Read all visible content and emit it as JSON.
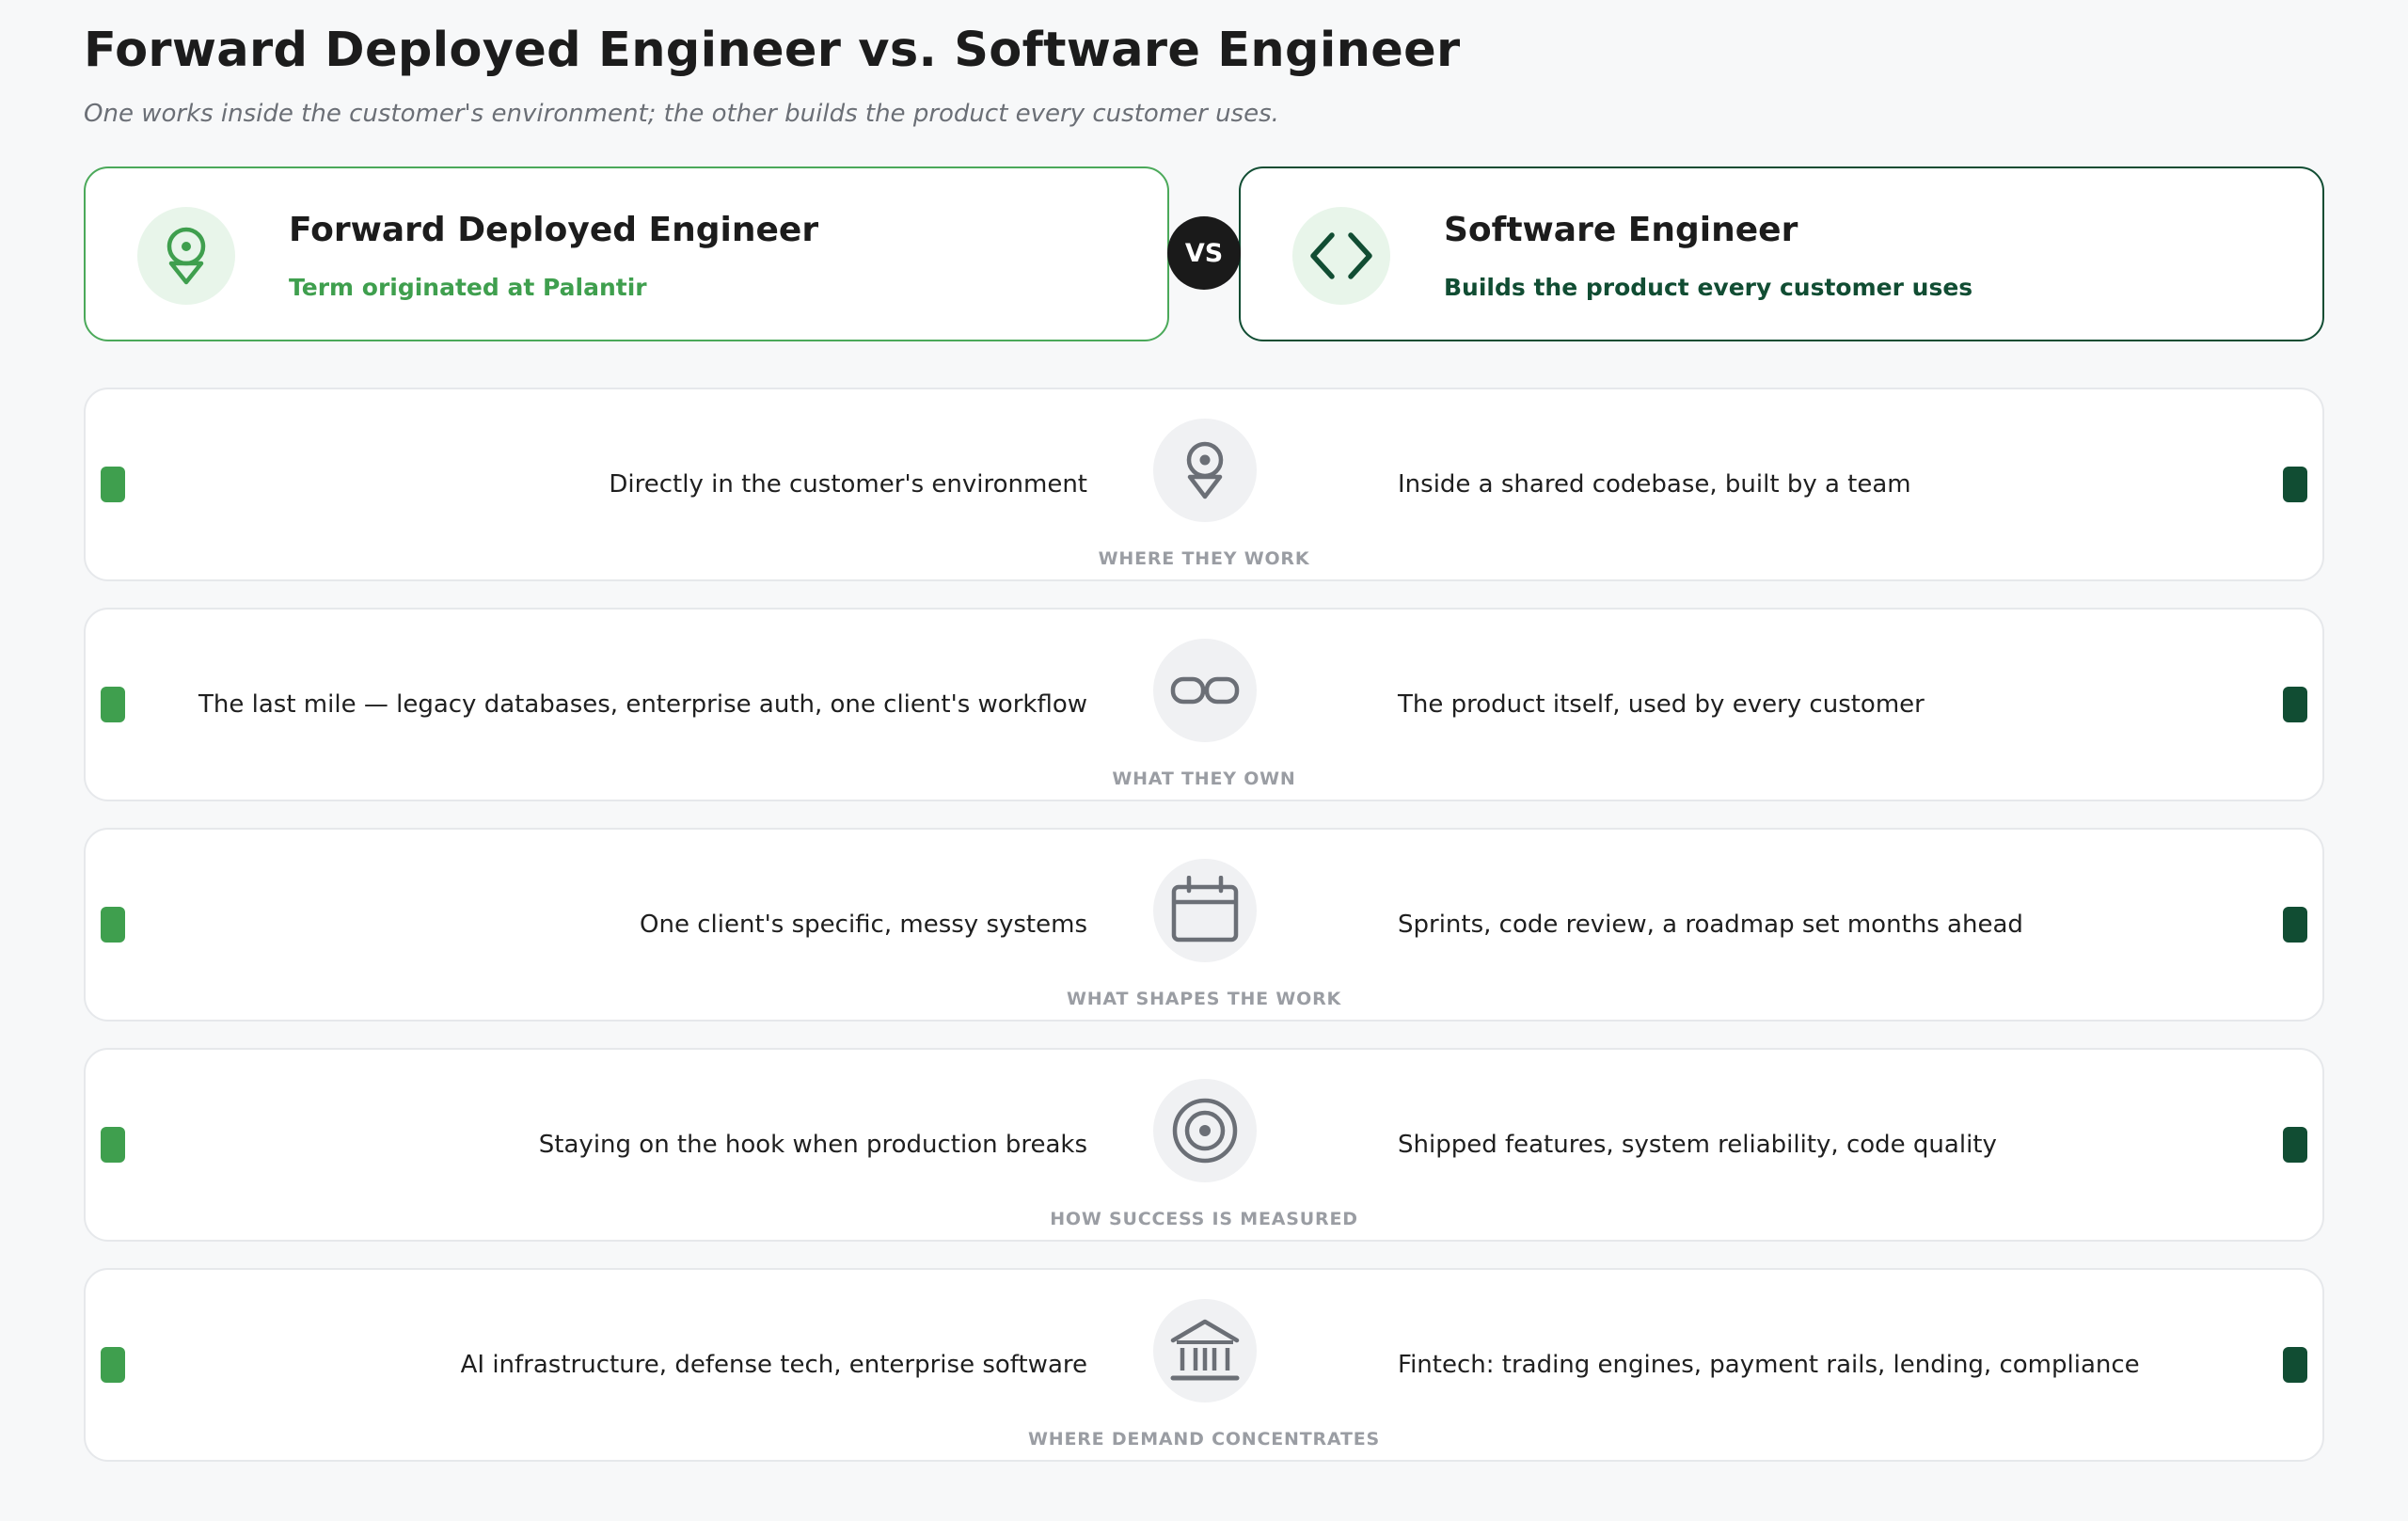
{
  "header": {
    "title": "Forward Deployed Engineer vs. Software Engineer",
    "subtitle": "One works inside the customer's environment; the other builds the product every customer uses."
  },
  "left_card": {
    "title": "Forward Deployed Engineer",
    "subtitle": "Term originated at Palantir",
    "icon": "location-pin-icon",
    "accent_color": "#3f9f4e"
  },
  "right_card": {
    "title": "Software Engineer",
    "subtitle": "Builds the product every customer uses",
    "icon": "code-brackets-icon",
    "accent_color": "#114d33"
  },
  "vs_label": "VS",
  "rows": [
    {
      "label": "WHERE THEY WORK",
      "icon": "location-pin-icon",
      "left": "Directly in the customer's environment",
      "right": "Inside a shared codebase, built by a team"
    },
    {
      "label": "WHAT THEY OWN",
      "icon": "link-icon",
      "left": "The last mile — legacy databases, enterprise auth, one client's workflow",
      "right": "The product itself, used by every customer"
    },
    {
      "label": "WHAT SHAPES THE WORK",
      "icon": "calendar-icon",
      "left": "One client's specific, messy systems",
      "right": "Sprints, code review, a roadmap set months ahead"
    },
    {
      "label": "HOW SUCCESS IS MEASURED",
      "icon": "target-icon",
      "left": "Staying on the hook when production breaks",
      "right": "Shipped features, system reliability, code quality"
    },
    {
      "label": "WHERE DEMAND CONCENTRATES",
      "icon": "bank-icon",
      "left": "AI infrastructure, defense tech, enterprise software",
      "right": "Fintech: trading engines, payment rails, lending, compliance"
    }
  ]
}
